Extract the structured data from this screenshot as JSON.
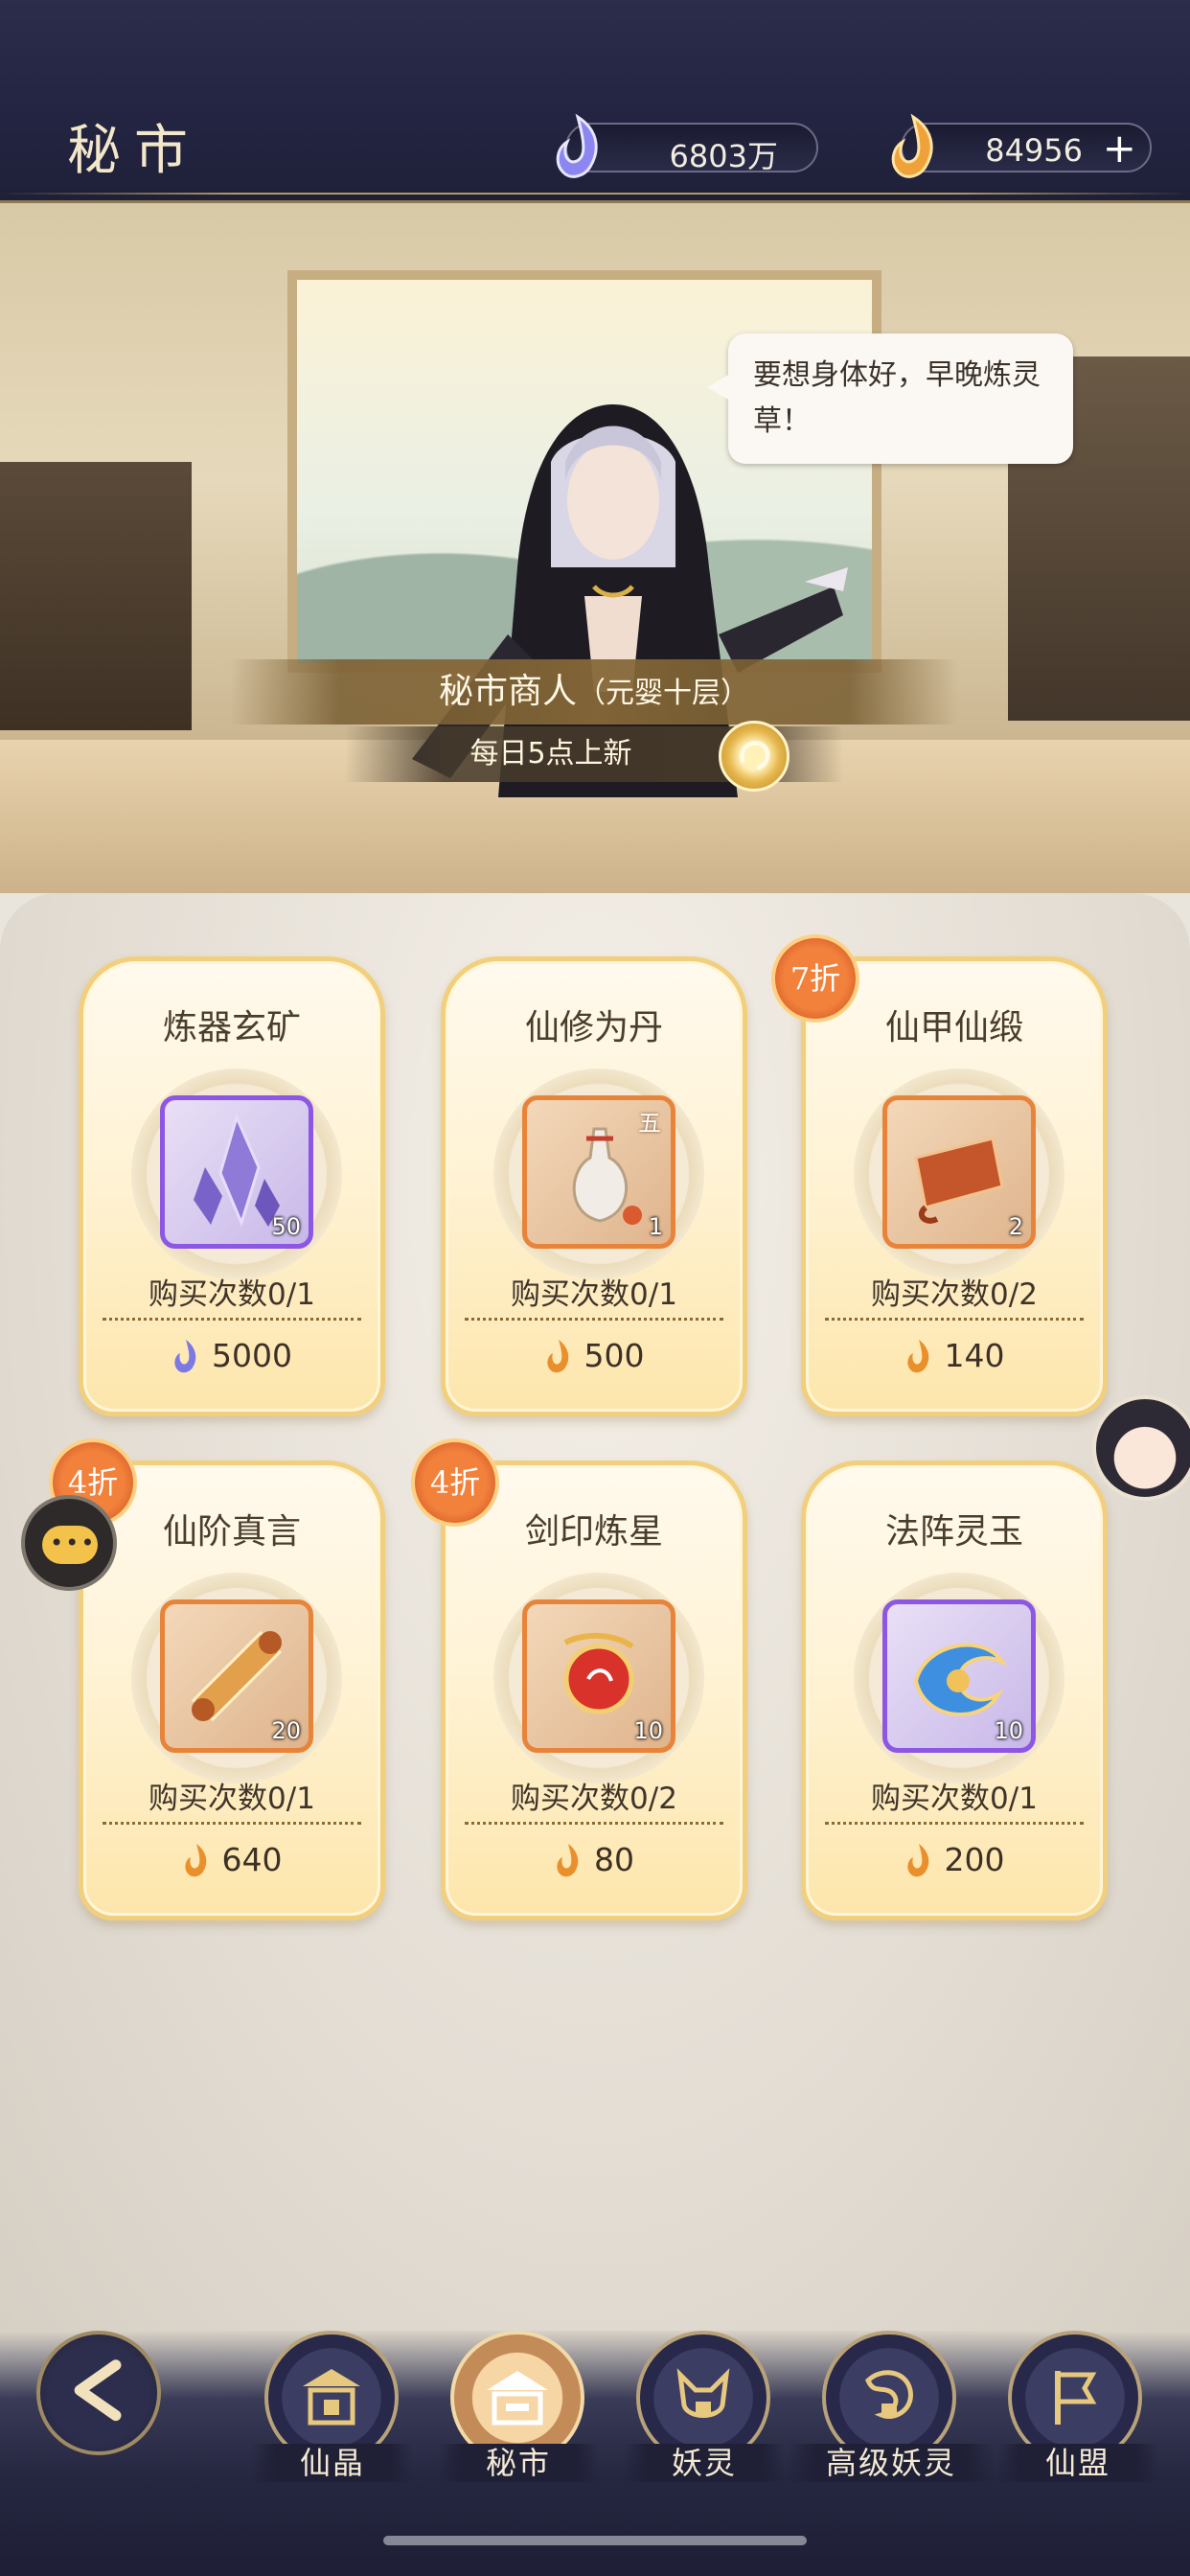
{
  "header": {
    "title": "秘市",
    "jade_amount": "6803万",
    "gold_amount": "84956",
    "add_label": "+"
  },
  "merchant": {
    "speech": "要想身体好，早晚炼灵草！",
    "name": "秘市商人",
    "realm": "（元婴十层）",
    "refresh_text": "每日5点上新"
  },
  "shop": {
    "items": [
      {
        "title": "炼器玄矿",
        "qty": "50",
        "limit": "购买次数0/1",
        "price": "5000",
        "currency": "jade",
        "frame": "purple",
        "discount": ""
      },
      {
        "title": "仙修为丹",
        "qty": "1",
        "grade": "五",
        "limit": "购买次数0/1",
        "price": "500",
        "currency": "gold",
        "frame": "orange",
        "discount": ""
      },
      {
        "title": "仙甲仙缎",
        "qty": "2",
        "limit": "购买次数0/2",
        "price": "140",
        "currency": "gold",
        "frame": "orange",
        "discount": "7折"
      },
      {
        "title": "仙阶真言",
        "qty": "20",
        "limit": "购买次数0/1",
        "price": "640",
        "currency": "gold",
        "frame": "orange",
        "discount": "4折"
      },
      {
        "title": "剑印炼星",
        "qty": "10",
        "limit": "购买次数0/2",
        "price": "80",
        "currency": "gold",
        "frame": "orange",
        "discount": "4折"
      },
      {
        "title": "法阵灵玉",
        "qty": "10",
        "limit": "购买次数0/1",
        "price": "200",
        "currency": "gold",
        "frame": "purple",
        "discount": ""
      }
    ]
  },
  "nav": {
    "tabs": [
      {
        "label": "仙晶",
        "active": false
      },
      {
        "label": "秘市",
        "active": true
      },
      {
        "label": "妖灵",
        "active": false
      },
      {
        "label": "高级妖灵",
        "active": false
      },
      {
        "label": "仙盟",
        "active": false
      }
    ]
  },
  "colors": {
    "header_bg": "#232441",
    "card_border": "#f1cf7c",
    "discount_badge": "#e5692f",
    "rare_purple": "#8d56e4",
    "uncommon_orange": "#e8843a"
  }
}
